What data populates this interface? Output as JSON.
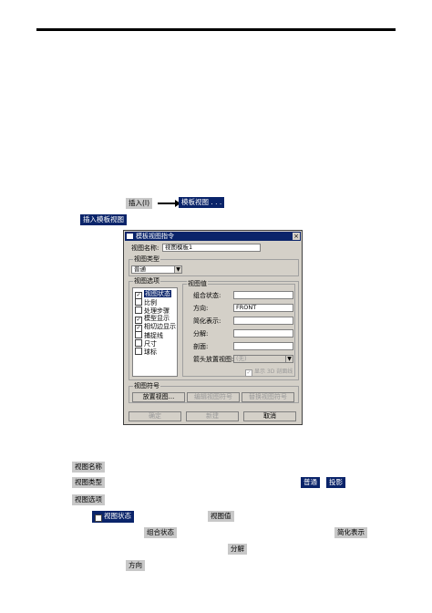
{
  "menu": {
    "insert_label": "插入(I)",
    "template_view_label": "模板视图 . . .",
    "insert_template_view_label": "插入模板视图"
  },
  "dialog": {
    "title": "模板视图指令",
    "close_glyph": "×",
    "view_name_label": "视图名称:",
    "view_name_value": "视图模板1",
    "view_type_group": "视图类型",
    "view_type_value": "普通",
    "view_options_group": "视图选项",
    "options": [
      {
        "label": "视图状态",
        "checked": true,
        "selected": true
      },
      {
        "label": "比例",
        "checked": false,
        "selected": false
      },
      {
        "label": "处理步骤",
        "checked": false,
        "selected": false
      },
      {
        "label": "模型显示",
        "checked": true,
        "selected": false
      },
      {
        "label": "相切边显示",
        "checked": true,
        "selected": false
      },
      {
        "label": "捕捉线",
        "checked": false,
        "selected": false
      },
      {
        "label": "尺寸",
        "checked": false,
        "selected": false
      },
      {
        "label": "球标",
        "checked": false,
        "selected": false
      }
    ],
    "view_values_group": "视图值",
    "combo_state_label": "组合状态:",
    "combo_state_value": "",
    "orientation_label": "方向:",
    "orientation_value": "FRONT",
    "simplified_label": "简化表示:",
    "simplified_value": "",
    "explode_label": "分解:",
    "explode_value": "",
    "section_label": "剖面:",
    "section_value": "",
    "arrow_view_label": "箭头放置视图:",
    "arrow_view_value": "(无)",
    "show_3d_section_label": "显示 3D 剖面线",
    "view_symbol_group": "视图符号",
    "place_view_button": "放置视图...",
    "edit_symbol_button": "编辑视图符号",
    "replace_symbol_button": "替换视图符号",
    "ok_button": "确定",
    "new_button": "新建",
    "cancel_button": "取消"
  },
  "notes": {
    "view_name": "视图名称",
    "view_type": "视图类型",
    "normal": "普通",
    "projection": "投影",
    "view_options": "视图选项",
    "view_state": "视图状态",
    "view_values": "视图值",
    "combo_state": "组合状态",
    "simplified": "简化表示",
    "explode": "分解",
    "orientation": "方向"
  },
  "colors": {
    "highlight": "#0a246a",
    "chip_gray": "#c8c8c8",
    "dialog_face": "#d4d0c8"
  }
}
